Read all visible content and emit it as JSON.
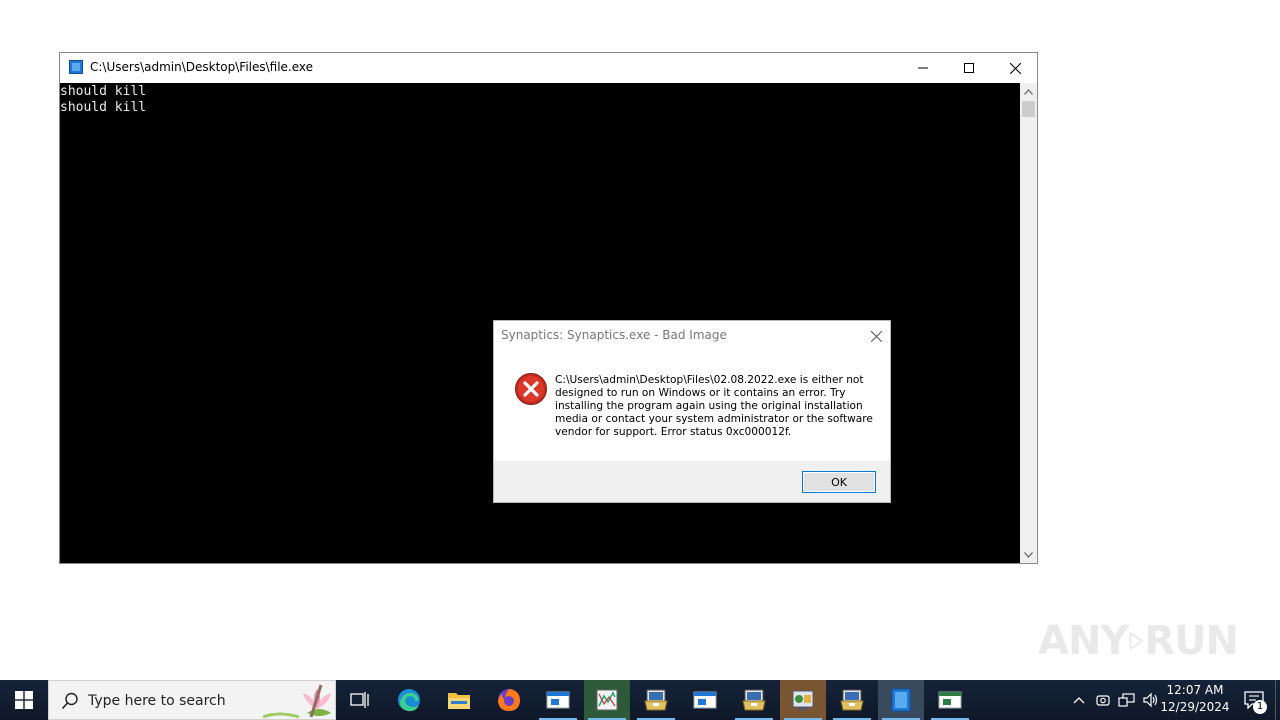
{
  "console_window": {
    "title": "C:\\Users\\admin\\Desktop\\Files\\file.exe",
    "output_lines": [
      "should kill",
      "should kill"
    ]
  },
  "error_dialog": {
    "title": "Synaptics: Synaptics.exe - Bad Image",
    "message": "C:\\Users\\admin\\Desktop\\Files\\02.08.2022.exe is either not designed to run on Windows or it contains an error. Try installing the program again using the original installation media or contact your system administrator or the software vendor for support. Error status 0xc000012f.",
    "ok_label": "OK",
    "icon": "error-icon"
  },
  "watermark": {
    "left": "ANY",
    "right": "RUN"
  },
  "taskbar": {
    "search_placeholder": "Type here to search",
    "pinned": [
      "task-view-icon",
      "edge-icon",
      "file-explorer-icon",
      "firefox-icon",
      "window-app-icon",
      "chart-app-icon",
      "installer-icon",
      "window-app-icon",
      "installer-icon",
      "control-panel-icon",
      "installer-icon",
      "console-app-icon",
      "window-app-icon"
    ],
    "clock_time": "12:07 AM",
    "clock_date": "12/29/2024",
    "notification_count": "1"
  },
  "colors": {
    "console_bg": "#000000",
    "console_text": "#ececec",
    "taskbar_bg": "#0f1a2b",
    "accent": "#0078d7",
    "error_red": "#c42b1c"
  }
}
